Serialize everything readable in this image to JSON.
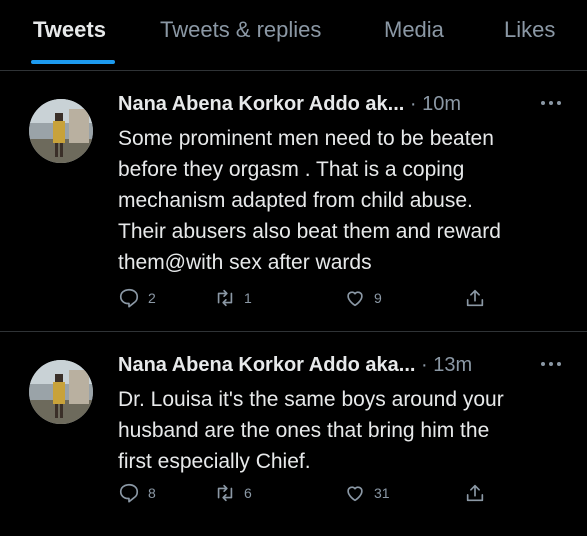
{
  "tabs": [
    {
      "label": "Tweets"
    },
    {
      "label": "Tweets & replies"
    },
    {
      "label": "Media"
    },
    {
      "label": "Likes"
    }
  ],
  "tweets": [
    {
      "name": "Nana Abena Korkor Addo ak...",
      "sep": "·",
      "time": "10m",
      "text": "Some prominent men need to be beaten\nbefore they orgasm . That is a coping\nmechanism adapted from child abuse.\nTheir abusers also beat them and reward\nthem@with sex after wards",
      "replies": "2",
      "retweets": "1",
      "likes": "9"
    },
    {
      "name": "Nana Abena Korkor Addo aka...",
      "sep": "·",
      "time": "13m",
      "text": "Dr. Louisa it's the same boys around your\nhusband are the ones that bring him the\nfirst especially Chief.",
      "replies": "8",
      "retweets": "6",
      "likes": "31"
    }
  ],
  "icons": {
    "more": "more-icon",
    "reply": "reply-icon",
    "retweet": "retweet-icon",
    "like": "heart-icon",
    "share": "share-icon"
  },
  "colors": {
    "accent": "#1d9bf0",
    "secondary_text": "#8b98a5",
    "primary_text": "#e7e9ea",
    "background": "#000000"
  }
}
